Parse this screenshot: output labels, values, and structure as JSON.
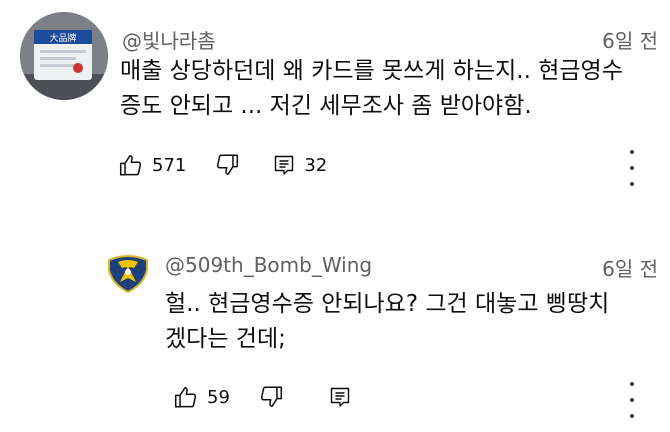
{
  "comment": {
    "author": "@빛나라촘",
    "time": "6일 전",
    "text_line1": "매출 상당하던데 왜 카드를 못쓰게 하는지.. 현금영수",
    "text_line2": "증도 안되고 ... 저긴 세무조사 좀 받아야함.",
    "likes": "571",
    "replies": "32",
    "avatar_label": "大品牌"
  },
  "reply": {
    "author": "@509th_Bomb_Wing",
    "time": "6일 전",
    "text_line1": "헐.. 현금영수증 안되나요? 그건 대놓고 삥땅치",
    "text_line2": "겠다는 건데;",
    "likes": "59"
  },
  "icons": [
    "thumbs-up-icon",
    "thumbs-down-icon",
    "reply-icon",
    "more-vert-icon"
  ],
  "colors": {
    "meta": "#606060",
    "text": "#0f0f0f",
    "background": "#ffffff"
  }
}
